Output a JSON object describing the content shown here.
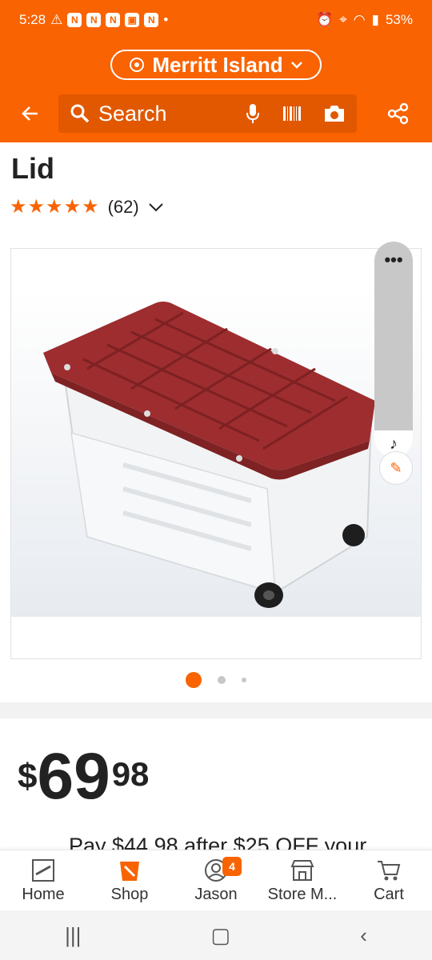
{
  "status_bar": {
    "time": "5:28",
    "battery": "53%"
  },
  "header": {
    "location": "Merritt Island",
    "search_placeholder": "Search"
  },
  "product": {
    "title": "Lid",
    "rating_stars": "★★★★★",
    "review_count": "(62)",
    "price": {
      "currency": "$",
      "whole": "69",
      "cents": "98"
    },
    "promo_text": "Pay $44.98 after $25 OFF your"
  },
  "bottom_nav": {
    "items": [
      {
        "label": "Home"
      },
      {
        "label": "Shop"
      },
      {
        "label": "Jason",
        "badge": "4"
      },
      {
        "label": "Store M..."
      },
      {
        "label": "Cart"
      }
    ]
  },
  "colors": {
    "brand": "#f96302",
    "lid": "#9d2d2f"
  }
}
